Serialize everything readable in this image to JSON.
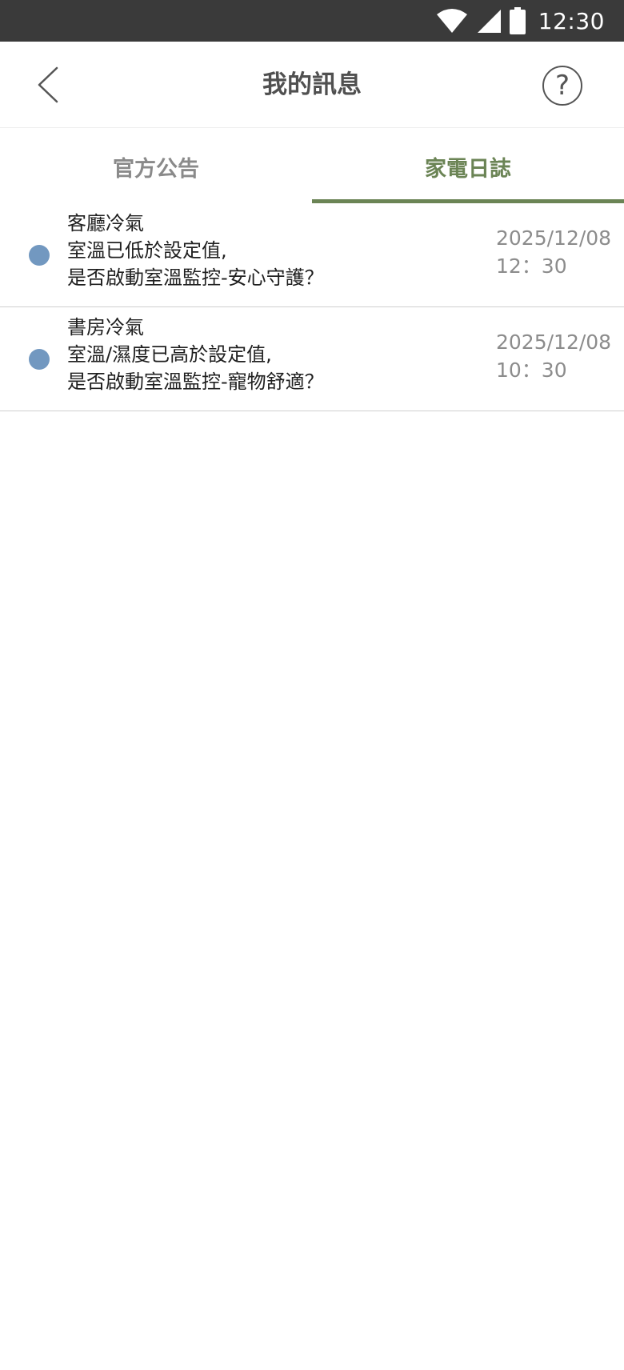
{
  "status_bar": {
    "time": "12:30",
    "icons": [
      "wifi-icon",
      "cellular-signal-icon",
      "battery-icon"
    ]
  },
  "header": {
    "title": "我的訊息",
    "back_icon": "chevron-left-icon",
    "help_label": "?"
  },
  "tabs": [
    {
      "label": "官方公告",
      "active": false
    },
    {
      "label": "家電日誌",
      "active": true
    }
  ],
  "messages": [
    {
      "device": "客廳冷氣",
      "line1": "室溫已低於設定值,",
      "line2": "是否啟動室溫監控-安心守護？",
      "date": "2025/12/08",
      "time": "12：30",
      "unread": true
    },
    {
      "device": "書房冷氣",
      "line1": "室溫/濕度已高於設定值,",
      "line2": "是否啟動室溫監控-寵物舒適？",
      "date": "2025/12/08",
      "time": "10：30",
      "unread": true
    }
  ],
  "colors": {
    "accent": "#6b8455",
    "unread_dot": "#7298c0",
    "status_bar": "#3a3a3a"
  }
}
